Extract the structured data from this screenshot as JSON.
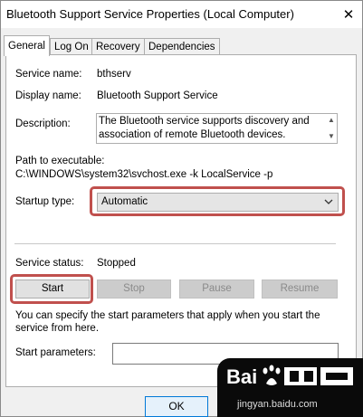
{
  "window": {
    "title": "Bluetooth Support Service Properties (Local Computer)",
    "close_glyph": "✕"
  },
  "tabs": [
    {
      "label": "General",
      "active": true
    },
    {
      "label": "Log On",
      "active": false
    },
    {
      "label": "Recovery",
      "active": false
    },
    {
      "label": "Dependencies",
      "active": false
    }
  ],
  "general": {
    "service_name_label": "Service name:",
    "service_name_value": "bthserv",
    "display_name_label": "Display name:",
    "display_name_value": "Bluetooth Support Service",
    "description_label": "Description:",
    "description_value": "The Bluetooth service supports discovery and association of remote Bluetooth devices.  Stopping",
    "path_label": "Path to executable:",
    "path_value": "C:\\WINDOWS\\system32\\svchost.exe -k LocalService -p",
    "startup_type_label": "Startup type:",
    "startup_type_value": "Automatic",
    "service_status_label": "Service status:",
    "service_status_value": "Stopped",
    "buttons": {
      "start": "Start",
      "stop": "Stop",
      "pause": "Pause",
      "resume": "Resume"
    },
    "help_text": "You can specify the start parameters that apply when you start the service from here.",
    "start_params_label": "Start parameters:",
    "start_params_value": ""
  },
  "footer": {
    "ok_label": "OK"
  },
  "watermark": {
    "url": "jingyan.baidu.com"
  },
  "colors": {
    "highlight": "#c0504d",
    "ok_border": "#0078d7"
  }
}
